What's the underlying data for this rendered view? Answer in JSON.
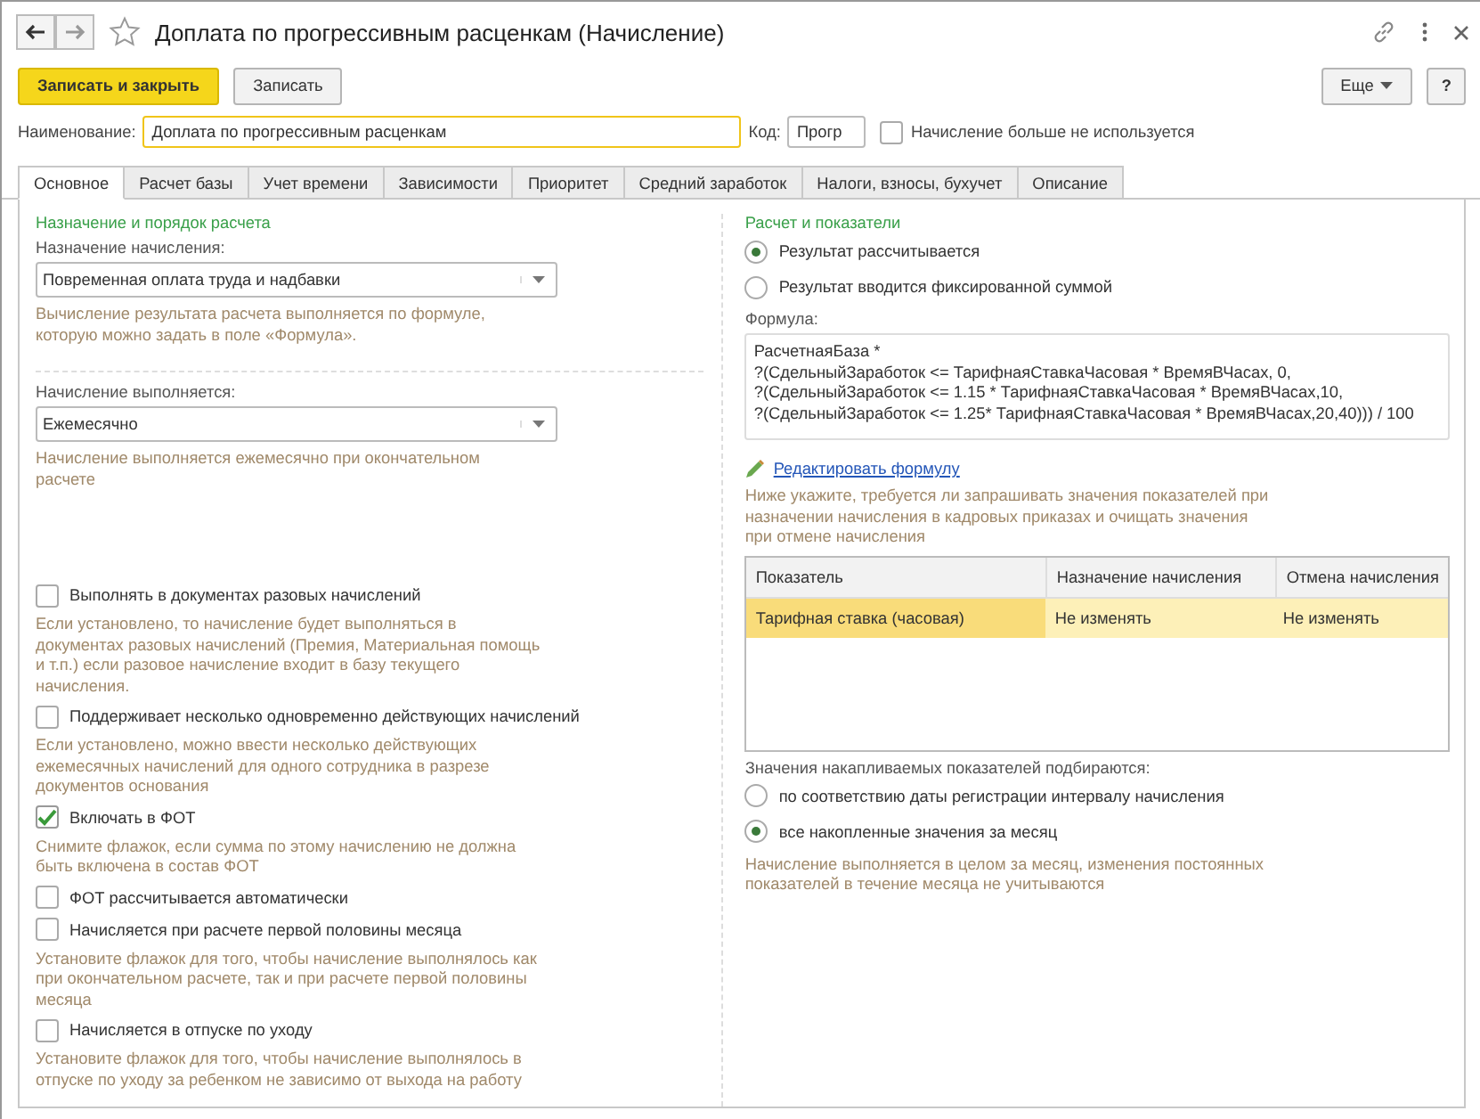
{
  "window": {
    "title": "Доплата по прогрессивным расценкам (Начисление)"
  },
  "toolbar": {
    "primary": "Записать и закрыть",
    "secondary": "Записать",
    "more": "Еще",
    "help": "?"
  },
  "name_row": {
    "name_label": "Наименование:",
    "name_value": "Доплата по прогрессивным расценкам",
    "code_label": "Код:",
    "code_value": "Прогр",
    "unused": {
      "label": "Начисление больше не используется",
      "checked": false
    }
  },
  "tabs": [
    {
      "label": "Основное",
      "selected": true
    },
    {
      "label": "Расчет базы",
      "selected": false
    },
    {
      "label": "Учет времени",
      "selected": false
    },
    {
      "label": "Зависимости",
      "selected": false
    },
    {
      "label": "Приоритет",
      "selected": false
    },
    {
      "label": "Средний заработок",
      "selected": false
    },
    {
      "label": "Налоги, взносы, бухучет",
      "selected": false
    },
    {
      "label": "Описание",
      "selected": false
    }
  ],
  "left": {
    "title": "Назначение и порядок расчета",
    "purpose_label": "Назначение начисления:",
    "purpose_value": "Повременная оплата труда и надбавки",
    "purpose_hint": "Вычисление результата расчета выполняется по формуле, которую можно задать в поле «Формула».",
    "period_label": "Начисление выполняется:",
    "period_value": "Ежемесячно",
    "period_hint": "Начисление выполняется ежемесячно при окончательном расчете",
    "options": [
      {
        "label": "Выполнять в документах разовых начислений",
        "checked": false,
        "hint": "Если установлено, то начисление будет выполняться в документах разовых начислений (Премия, Материальная помощь и т.п.) если разовое начисление входит в базу текущего начисления."
      },
      {
        "label": "Поддерживает несколько одновременно действующих начислений",
        "checked": false,
        "hint": "Если установлено, можно ввести несколько действующих ежемесячных начислений для одного сотрудника в разрезе документов основания"
      },
      {
        "label": "Включать в ФОТ",
        "checked": true,
        "hint": "Снимите флажок, если сумма по этому начислению не должна быть включена в состав ФОТ"
      },
      {
        "label": "ФОТ рассчитывается автоматически",
        "checked": false
      },
      {
        "label": "Начисляется при расчете первой половины месяца",
        "checked": false,
        "hint": "Установите флажок для того, чтобы начисление выполнялось как при окончательном расчете, так и при расчете первой половины месяца"
      },
      {
        "label": "Начисляется в отпуске по уходу",
        "checked": false,
        "hint": "Установите флажок для того, чтобы начисление выполнялось в отпуске по уходу за ребенком не зависимо от выхода на работу"
      }
    ]
  },
  "right": {
    "title": "Расчет и показатели",
    "result_modes": [
      {
        "label": "Результат рассчитывается",
        "selected": true
      },
      {
        "label": "Результат вводится фиксированной суммой",
        "selected": false
      }
    ],
    "formula_label": "Формула:",
    "formula_lines": [
      "РасчетнаяБаза *",
      "?(СдельныйЗаработок <= ТарифнаяСтавкаЧасовая * ВремяВЧасах, 0,",
      "?(СдельныйЗаработок <= 1.15 * ТарифнаяСтавкаЧасовая * ВремяВЧасах,10,",
      "?(СдельныйЗаработок <= 1.25* ТарифнаяСтавкаЧасовая * ВремяВЧасах,20,40))) / 100"
    ],
    "edit_link": "Редактировать формулу",
    "indicators_hint": "Ниже укажите, требуется ли запрашивать значения показателей при назначении начисления в кадровых приказах и очищать значения при отмене начисления",
    "table": {
      "columns": [
        "Показатель",
        "Назначение начисления",
        "Отмена начисления"
      ],
      "rows": [
        {
          "cells": [
            "Тарифная ставка (часовая)",
            "Не изменять",
            "Не изменять"
          ],
          "selected": true
        }
      ]
    },
    "accum_label": "Значения накапливаемых показателей подбираются:",
    "accum_modes": [
      {
        "label": "по соответствию даты регистрации интервалу начисления",
        "selected": false
      },
      {
        "label": "все накопленные значения за месяц",
        "selected": true
      }
    ],
    "accum_hint": "Начисление выполняется в целом за месяц, изменения постоянных показателей в течение месяца не учитываются"
  }
}
